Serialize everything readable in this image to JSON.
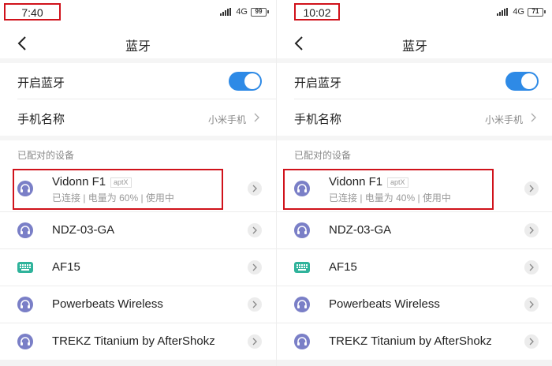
{
  "screens": [
    {
      "status_bar": {
        "time": "7:40",
        "network": "4G",
        "battery": "99"
      },
      "header": {
        "title": "蓝牙"
      },
      "bluetooth_toggle": {
        "label": "开启蓝牙",
        "on": true
      },
      "device_name": {
        "label": "手机名称",
        "value": "小米手机"
      },
      "paired_section_title": "已配对的设备",
      "devices": [
        {
          "name": "Vidonn F1",
          "codec": "aptX",
          "status": "已连接 | 电量为 60% | 使用中",
          "icon": "headset-icon"
        },
        {
          "name": "NDZ-03-GA",
          "icon": "headset-icon"
        },
        {
          "name": "AF15",
          "icon": "keyboard-icon"
        },
        {
          "name": "Powerbeats Wireless",
          "icon": "headset-icon"
        },
        {
          "name": "TREKZ Titanium by AfterShokz",
          "icon": "headset-icon"
        }
      ]
    },
    {
      "status_bar": {
        "time": "10:02",
        "network": "4G",
        "battery": "71"
      },
      "header": {
        "title": "蓝牙"
      },
      "bluetooth_toggle": {
        "label": "开启蓝牙",
        "on": true
      },
      "device_name": {
        "label": "手机名称",
        "value": "小米手机"
      },
      "paired_section_title": "已配对的设备",
      "devices": [
        {
          "name": "Vidonn F1",
          "codec": "aptX",
          "status": "已连接 | 电量为 40% | 使用中",
          "icon": "headset-icon"
        },
        {
          "name": "NDZ-03-GA",
          "icon": "headset-icon"
        },
        {
          "name": "AF15",
          "icon": "keyboard-icon"
        },
        {
          "name": "Powerbeats Wireless",
          "icon": "headset-icon"
        },
        {
          "name": "TREKZ Titanium by AfterShokz",
          "icon": "headset-icon"
        }
      ]
    }
  ],
  "colors": {
    "accent": "#2e8ae6",
    "highlight": "#d0121b",
    "headset_icon": "#7a7fc7",
    "keyboard_icon": "#2fb39b"
  }
}
